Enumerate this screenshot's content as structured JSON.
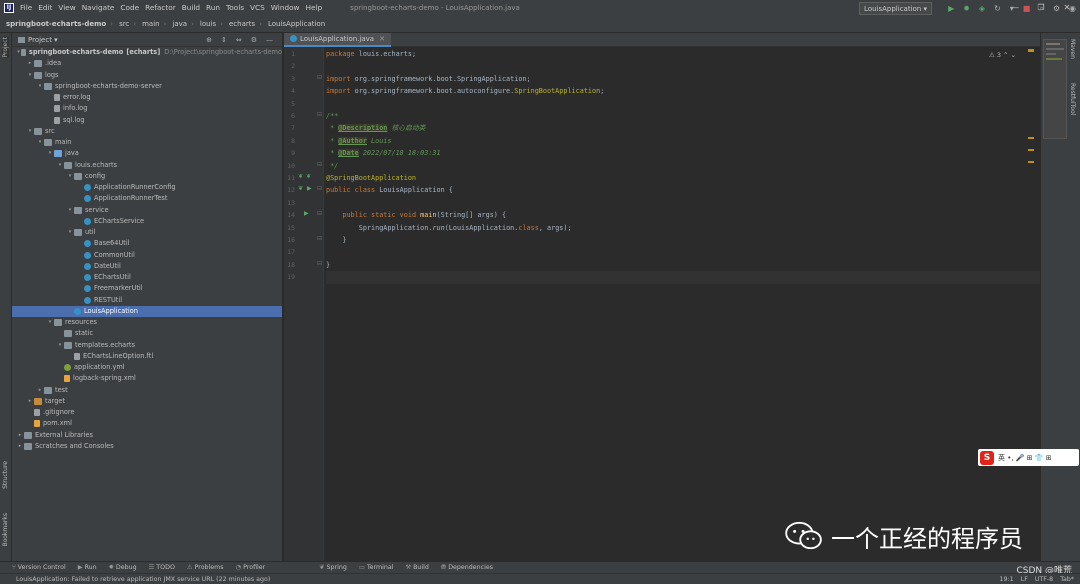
{
  "menubar": {
    "logo": "IJ",
    "items": [
      "File",
      "Edit",
      "View",
      "Navigate",
      "Code",
      "Refactor",
      "Build",
      "Run",
      "Tools",
      "VCS",
      "Window",
      "Help"
    ],
    "window_title": "springboot-echarts-demo - LouisApplication.java"
  },
  "navbar": {
    "crumbs": [
      "springboot-echarts-demo",
      "src",
      "main",
      "java",
      "louis",
      "echarts",
      "LouisApplication"
    ],
    "run_config": "LouisApplication ▾"
  },
  "project_panel": {
    "title": "Project ▾",
    "tree": [
      {
        "depth": 0,
        "arrow": "▾",
        "icon": "folder",
        "label": "springboot-echarts-demo",
        "bold_suffix": "[echarts]",
        "path": "D:\\Project\\springboot-echarts-demo"
      },
      {
        "depth": 1,
        "arrow": "▸",
        "icon": "folder",
        "label": ".idea"
      },
      {
        "depth": 1,
        "arrow": "▾",
        "icon": "folder",
        "label": "logs"
      },
      {
        "depth": 2,
        "arrow": "▾",
        "icon": "folder",
        "label": "springboot-echarts-demo-server"
      },
      {
        "depth": 3,
        "arrow": "",
        "icon": "file",
        "label": "error.log"
      },
      {
        "depth": 3,
        "arrow": "",
        "icon": "file",
        "label": "info.log"
      },
      {
        "depth": 3,
        "arrow": "",
        "icon": "file",
        "label": "sql.log"
      },
      {
        "depth": 1,
        "arrow": "▾",
        "icon": "folder",
        "label": "src"
      },
      {
        "depth": 2,
        "arrow": "▾",
        "icon": "folder",
        "label": "main"
      },
      {
        "depth": 3,
        "arrow": "▾",
        "icon": "folder-blue",
        "label": "java"
      },
      {
        "depth": 4,
        "arrow": "▾",
        "icon": "folder",
        "label": "louis.echarts"
      },
      {
        "depth": 5,
        "arrow": "▾",
        "icon": "folder",
        "label": "config"
      },
      {
        "depth": 6,
        "arrow": "",
        "icon": "cls",
        "label": "ApplicationRunnerConfig"
      },
      {
        "depth": 6,
        "arrow": "",
        "icon": "cls",
        "label": "ApplicationRunnerTest"
      },
      {
        "depth": 5,
        "arrow": "▾",
        "icon": "folder",
        "label": "service"
      },
      {
        "depth": 6,
        "arrow": "",
        "icon": "cls",
        "label": "EChartsService"
      },
      {
        "depth": 5,
        "arrow": "▾",
        "icon": "folder",
        "label": "util"
      },
      {
        "depth": 6,
        "arrow": "",
        "icon": "cls",
        "label": "Base64Util"
      },
      {
        "depth": 6,
        "arrow": "",
        "icon": "cls",
        "label": "CommonUtil"
      },
      {
        "depth": 6,
        "arrow": "",
        "icon": "cls",
        "label": "DateUtil"
      },
      {
        "depth": 6,
        "arrow": "",
        "icon": "cls",
        "label": "EChartsUtil"
      },
      {
        "depth": 6,
        "arrow": "",
        "icon": "cls",
        "label": "FreemarkerUtil"
      },
      {
        "depth": 6,
        "arrow": "",
        "icon": "cls",
        "label": "RESTUtil"
      },
      {
        "depth": 5,
        "arrow": "",
        "icon": "cls",
        "label": "LouisApplication",
        "selected": true
      },
      {
        "depth": 3,
        "arrow": "▾",
        "icon": "folder",
        "label": "resources"
      },
      {
        "depth": 4,
        "arrow": "",
        "icon": "folder",
        "label": "static"
      },
      {
        "depth": 4,
        "arrow": "▾",
        "icon": "folder",
        "label": "templates.echarts"
      },
      {
        "depth": 5,
        "arrow": "",
        "icon": "file",
        "label": "EChartsLineOption.ftl"
      },
      {
        "depth": 4,
        "arrow": "",
        "icon": "yml",
        "label": "application.yml"
      },
      {
        "depth": 4,
        "arrow": "",
        "icon": "xml",
        "label": "logback-spring.xml"
      },
      {
        "depth": 2,
        "arrow": "▸",
        "icon": "folder",
        "label": "test"
      },
      {
        "depth": 1,
        "arrow": "▸",
        "icon": "folder-orange",
        "label": "target"
      },
      {
        "depth": 1,
        "arrow": "",
        "icon": "file",
        "label": ".gitignore"
      },
      {
        "depth": 1,
        "arrow": "",
        "icon": "xml",
        "label": "pom.xml"
      },
      {
        "depth": 0,
        "arrow": "▸",
        "icon": "folder",
        "label": "External Libraries"
      },
      {
        "depth": 0,
        "arrow": "▸",
        "icon": "folder",
        "label": "Scratches and Consoles"
      }
    ]
  },
  "left_stripe": {
    "top": "Project",
    "mid": "Structure",
    "bottom": "Bookmarks"
  },
  "right_stripe": {
    "top": "Maven",
    "mid": "RestfulTool"
  },
  "editor": {
    "tab": "LouisApplication.java",
    "inspection": "⚠ 3 ⌃ ⌄",
    "lines": [
      {
        "n": "1",
        "html": "<span class='kw'>package</span> louis.echarts;"
      },
      {
        "n": "2",
        "html": ""
      },
      {
        "n": "3",
        "html": "<span class='kw'>import</span> org.springframework.boot.SpringApplication;"
      },
      {
        "n": "4",
        "html": "<span class='kw'>import</span> org.springframework.boot.autoconfigure.<span class='ann'>SpringBootApplication</span>;"
      },
      {
        "n": "5",
        "html": ""
      },
      {
        "n": "6",
        "html": "<span class='doc'>/**</span>"
      },
      {
        "n": "7",
        "html": "<span class='doc'> * </span><span class='tag'>@Description</span><span class='doc'> 核心启动类</span>"
      },
      {
        "n": "8",
        "html": "<span class='doc'> * </span><span class='tag'>@Author</span><span class='doc'> Louis</span>"
      },
      {
        "n": "9",
        "html": "<span class='doc'> * </span><span class='tag'>@Date</span><span class='doc'> 2022/07/18 18:03:31</span>"
      },
      {
        "n": "10",
        "html": "<span class='doc'> */</span>"
      },
      {
        "n": "11",
        "html": "<span class='ann'>@SpringBootApplication</span>"
      },
      {
        "n": "12",
        "html": "<span class='kw'>public class</span> LouisApplication {"
      },
      {
        "n": "13",
        "html": ""
      },
      {
        "n": "14",
        "html": "    <span class='kw'>public static void</span> <span class='fn'>main</span>(String[] args) {"
      },
      {
        "n": "15",
        "html": "        SpringApplication.<i>run</i>(LouisApplication.<span class='kw'>class</span>, args);"
      },
      {
        "n": "16",
        "html": "    }"
      },
      {
        "n": "17",
        "html": ""
      },
      {
        "n": "18",
        "html": "}"
      },
      {
        "n": "19",
        "html": ""
      }
    ]
  },
  "toolwindows": [
    "Version Control",
    "Run",
    "Debug",
    "TODO",
    "Problems",
    "Profiler",
    "Spring",
    "Terminal",
    "Build",
    "Dependencies"
  ],
  "status": {
    "message": "LouisApplication: Failed to retrieve application JMX service URL (22 minutes ago)",
    "right": [
      "19:1",
      "LF",
      "UTF-8",
      "Tab*"
    ]
  },
  "ime": {
    "logo": "S",
    "text": "英 •, 🎤 ⊞ 👕 ⊞"
  },
  "watermark": {
    "text": "一个正经的程序员",
    "csdn": "CSDN @唯荒"
  }
}
